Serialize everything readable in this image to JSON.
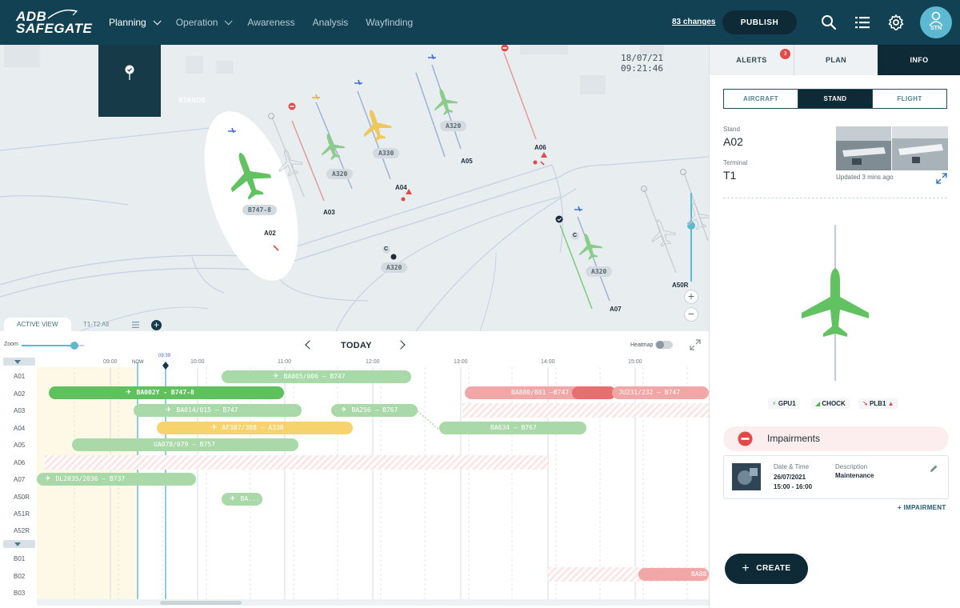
{
  "header": {
    "logo_line1": "ADB",
    "logo_line2": "SAFEGATE",
    "nav": [
      {
        "label": "Planning"
      },
      {
        "label": "Operation"
      },
      {
        "label": "Awareness"
      },
      {
        "label": "Analysis"
      },
      {
        "label": "Wayfinding"
      }
    ],
    "changes_label": "83 changes",
    "publish_label": "PUBLISH",
    "user_initials": "STN",
    "icons": [
      "search-icon",
      "list-icon",
      "gear-icon",
      "user-icon"
    ],
    "bg_color": "#114152"
  },
  "map": {
    "timestamp": "18/07/21  09:21:46",
    "stands_button_label": "STANDS",
    "stand_labels": [
      "A02",
      "A03",
      "A04",
      "A05",
      "A06",
      "A07",
      "A50R"
    ],
    "aircraft_tags": [
      "B747-8",
      "A320",
      "A330",
      "A320",
      "A320",
      "A320"
    ],
    "spot_label": "C",
    "spot_label_2": "C"
  },
  "view_tabs": {
    "active": "ACTIVE VIEW",
    "other": "T1-T2 All"
  },
  "timeline": {
    "zoom_label": "Zoom",
    "zoom_level": 0.84,
    "today_label": "TODAY",
    "heatmap_label": "Heatmap",
    "now_label": "NOW",
    "current_time": "09:39",
    "hours": [
      "09:00",
      "10:00",
      "11:00",
      "12:00",
      "13:00",
      "14:00",
      "15:00"
    ],
    "rows": [
      "A01",
      "A02",
      "A03",
      "A04",
      "A05",
      "A06",
      "A07",
      "A50R",
      "A51R",
      "A52R",
      "B01",
      "B02",
      "B03"
    ],
    "flights": [
      {
        "row": 0,
        "label": "BA005/006 – B747"
      },
      {
        "row": 1,
        "label": "BA002Y - B747-8"
      },
      {
        "row": 1,
        "label": "BA880/881 –B747"
      },
      {
        "row": 1,
        "label": "JU231/232 – B747"
      },
      {
        "row": 2,
        "label": "BA014/015 – B747"
      },
      {
        "row": 2,
        "label": "BA256 – B767"
      },
      {
        "row": 3,
        "label": "BA634 – B767"
      },
      {
        "row": 3,
        "label": "AF387/388 – A330"
      },
      {
        "row": 4,
        "label": "UA078/079 – B757"
      },
      {
        "row": 6,
        "label": "DL2035/2036 – B737"
      },
      {
        "row": 7,
        "label": "BA..."
      },
      {
        "row": 11,
        "label": "BA88"
      }
    ]
  },
  "panel": {
    "tabs": [
      {
        "label": "ALERTS",
        "badge": "3"
      },
      {
        "label": "PLAN"
      },
      {
        "label": "INFO"
      }
    ],
    "segments": [
      "AIRCRAFT",
      "STAND",
      "FLIGHT"
    ],
    "stand_key": "Stand",
    "stand_value": "A02",
    "terminal_key": "Terminal",
    "terminal_value": "T1",
    "updated": "Updated 3 mins ago",
    "equipment": [
      "GPU1",
      "CHOCK",
      "PLB1"
    ],
    "impairments_title": "Impairments",
    "impairment": {
      "date_key": "Date & Time",
      "date_value": "26/07/2021",
      "time_value": "15:00 - 16:00",
      "desc_key": "Description",
      "desc_value": "Maintenance"
    },
    "add_impairment": "+ IMPAIRMENT",
    "create_label": "CREATE"
  },
  "colors": {
    "primary_dark": "#0d2a36",
    "accent": "#5cb9d1",
    "green": "#5ec15d",
    "alert_red": "#e24a4a"
  }
}
